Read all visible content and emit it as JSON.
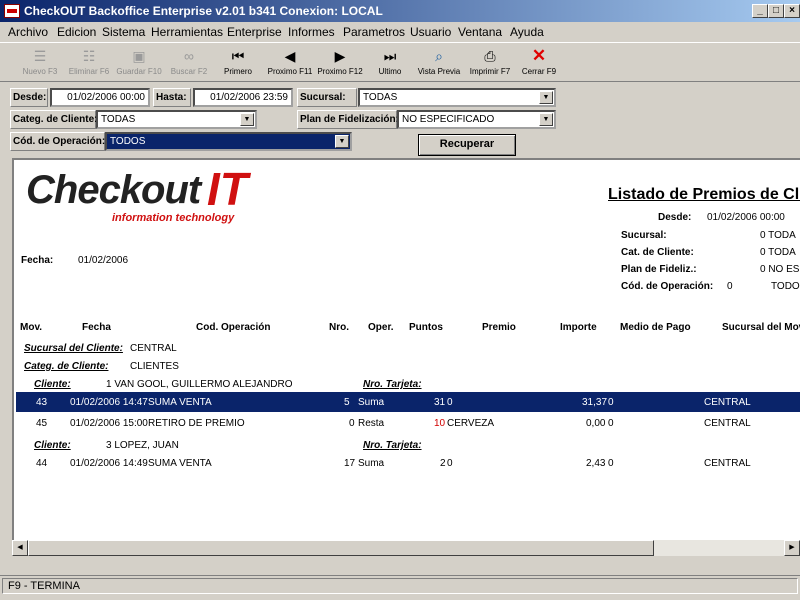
{
  "window": {
    "title": "CheckOUT Backoffice Enterprise v2.01 b341 Conexion: LOCAL"
  },
  "menu": [
    "Archivo",
    "Edicion",
    "Sistema",
    "Herramientas",
    "Enterprise",
    "Informes",
    "Parametros",
    "Usuario",
    "Ventana",
    "Ayuda"
  ],
  "toolbar": {
    "nuevo": "Nuevo F3",
    "eliminar": "Eliminar F6",
    "guardar": "Guardar F10",
    "buscar": "Buscar F2",
    "primero": "Primero",
    "proximo11": "Proximo F11",
    "proximo12": "Proximo F12",
    "ultimo": "Ultimo",
    "vista": "Vista Previa",
    "imprimir": "Imprimir F7",
    "cerrar": "Cerrar F9"
  },
  "filters": {
    "desde_label": "Desde:",
    "desde_value": "01/02/2006 00:00",
    "hasta_label": "Hasta:",
    "hasta_value": "01/02/2006 23:59",
    "sucursal_label": "Sucursal:",
    "sucursal_value": "TODAS",
    "categ_label": "Categ. de Cliente:",
    "categ_value": "TODAS",
    "plan_label": "Plan de Fidelización:",
    "plan_value": "NO ESPECIFICADO",
    "cod_label": "Cód. de Operación:",
    "cod_value": "TODOS",
    "recuperar": "Recuperar"
  },
  "report": {
    "logo_main": "Checkout",
    "logo_it": "IT",
    "logo_tag": "information technology",
    "title": "Listado de Premios de Cli",
    "fecha_label": "Fecha:",
    "fecha_value": "01/02/2006",
    "desde_label": "Desde:",
    "desde_value": "01/02/2006 00:00",
    "sucursal_label": "Sucursal:",
    "sucursal_value": "0 TODA",
    "cat_label": "Cat. de Cliente:",
    "cat_value": "0 TODA",
    "plan_label": "Plan de Fideliz.:",
    "plan_value": "0 NO ES",
    "cod_label": "Cód. de Operación:",
    "cod_value": "0",
    "cod_value2": "TODO",
    "columns": [
      "Mov.",
      "Fecha",
      "Cod. Operación",
      "Nro.",
      "Oper.",
      "Puntos",
      "Premio",
      "Importe",
      "Medio de Pago",
      "Sucursal del Mov"
    ],
    "sucursal_cliente_label": "Sucursal del Cliente:",
    "sucursal_cliente_value": "CENTRAL",
    "categ_cliente_label": "Categ. de Cliente:",
    "categ_cliente_value": "CLIENTES",
    "cliente_label": "Cliente:",
    "tarjeta_label": "Nro. Tarjeta:",
    "clients": [
      {
        "name": "1 VAN GOOL, GUILLERMO ALEJANDRO"
      },
      {
        "name": "3 LOPEZ, JUAN"
      }
    ],
    "rows": [
      {
        "mov": "43",
        "fecha": "01/02/2006 14:47",
        "cod": "SUMA VENTA",
        "nro": "5",
        "oper": "Suma",
        "puntos": "31",
        "premio": "0",
        "importe": "31,37",
        "medio": "0",
        "sucursal": "CENTRAL"
      },
      {
        "mov": "45",
        "fecha": "01/02/2006 15:00",
        "cod": "RETIRO DE PREMIO",
        "nro": "0",
        "oper": "Resta",
        "puntos": "10",
        "premio": "CERVEZA",
        "importe": "0,00",
        "medio": "0",
        "sucursal": "CENTRAL"
      },
      {
        "mov": "44",
        "fecha": "01/02/2006 14:49",
        "cod": "SUMA VENTA",
        "nro": "17",
        "oper": "Suma",
        "puntos": "2",
        "premio": "0",
        "importe": "2,43",
        "medio": "0",
        "sucursal": "CENTRAL"
      }
    ]
  },
  "status": {
    "text": "F9 - TERMINA"
  },
  "colors": {
    "accent": "#0a246a",
    "logo_red": "#d01010"
  }
}
